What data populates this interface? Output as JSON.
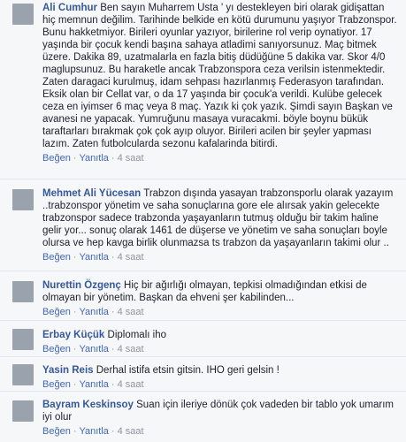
{
  "comments": [
    {
      "author": "Ali Cumhur",
      "text": "Ben sayın Muharrem Usta ' yı destekleyen biri olarak gidişattan hiç memnun değilim. Tarihinde belkide en kötü durumunu yaşıyor Trabzonspor. Bunu hakketmiyor. Birileri oyunlar yazıyor, birilerine rol verip oynatiyor. 17 yaşında bir çocuk kendi başına sahaya atladimi sanıyorsunuz. Maç bitmek üzere. Dakika 89, uzatmalarla en fazla bitiş düdüğüne 5 dakika var. Skor 4/0 maglupsunuz. Bu haraketle ancak Trabzonspora ceza verilsin istenmektedir. Zaten daragaci kurulmuş, idam sehpası hazırlanmış Federasyon tarafından. Eksik olan bir Cellat var, o da 17 yaşında bir çocuk'a verildi. Kulübe gelecek ceza en iyimser 6 maç veya 8 maç. Yazık ki çok yazık. Şimdi sayın Başkan ve avanesi ne yapacak. Yumruğunu masaya vuracakmi. böyle boynu bükük taraftarları bırakmak çok çok ayıp oluyor. Birileri acilen bir şeyler yapması lazım. Zaten futbolcularda sezonu kafalarinda bitirdi.",
      "like": "Beğen",
      "reply": "Yanıtla",
      "time": "4 saat"
    },
    {
      "author": "Mehmet Ali Yücesan",
      "text": "Trabzon dışında yasayan trabzonsporlu olarak yazayım ..trabzonspor yönetim ve saha sonuçlarına gore ele alırsak yakin gelecekte trabzonspor sadece trabzonda yaşayanların tutmuş olduğu bir takim haline gelir yor... sonuç olarak 1461 de düşerse ve yönetim ve saha sonuçları boyle olursa ve hep kavga birlik olunmazsa ts trabzon da yaşayanların takimi olur ..",
      "like": "Beğen",
      "reply": "Yanıtla",
      "time": "4 saat"
    },
    {
      "author": "Nurettin Özgenç",
      "text": "Hiç bir ağırlığı olmayan, tepkisi olmadığından etkisi de olmayan bir yönetim. Başkan da ehveni şer kabilinden...",
      "like": "Beğen",
      "reply": "Yanıtla",
      "time": "4 saat"
    },
    {
      "author": "Erbay Küçük",
      "text": "Diplomalı iho",
      "like": "Beğen",
      "reply": "Yanıtla",
      "time": "4 saat"
    },
    {
      "author": "Yasin Reis",
      "text": "Derhal istifa etsin gitsin. IHO geri gelsin !",
      "like": "Beğen",
      "reply": "Yanıtla",
      "time": "4 saat"
    },
    {
      "author": "Bayram Keskinsoy",
      "text": "Suan için ileriye dönük çok vadeden bir tablo yok umarım iyi olur",
      "like": "Beğen",
      "reply": "Yanıtla",
      "time": "4 saat"
    }
  ]
}
